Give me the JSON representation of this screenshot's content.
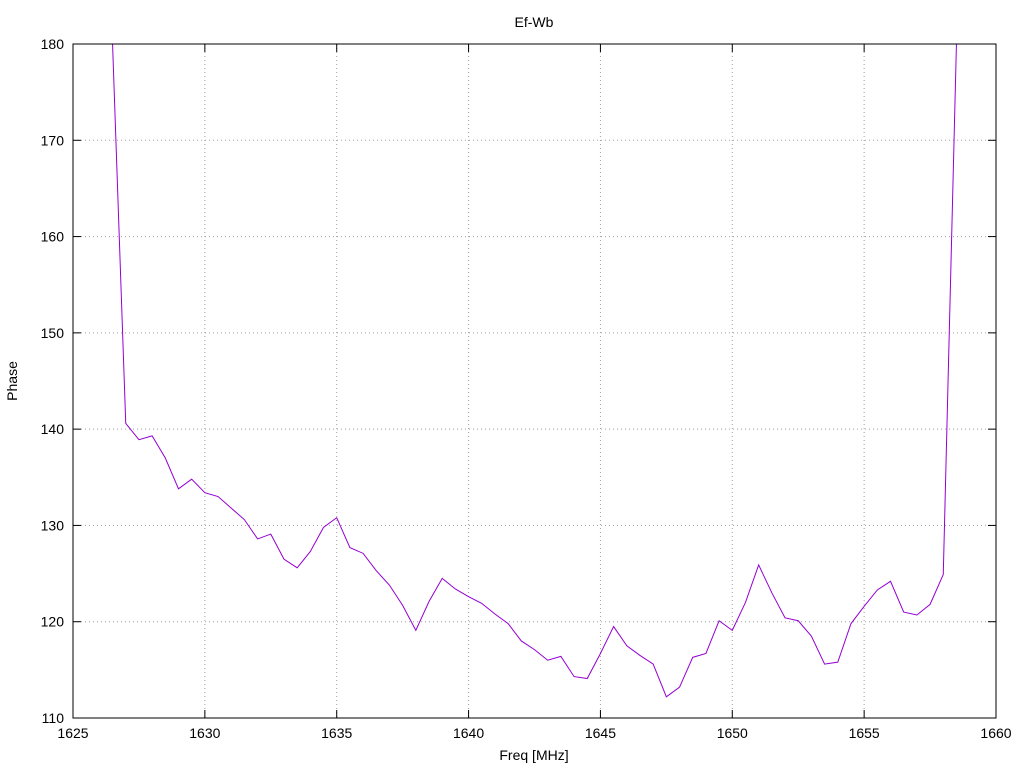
{
  "chart_data": {
    "type": "line",
    "title": "Ef-Wb",
    "xlabel": "Freq [MHz]",
    "ylabel": "Phase",
    "xlim": [
      1625,
      1660
    ],
    "ylim": [
      110,
      180
    ],
    "xticks": [
      1625,
      1630,
      1635,
      1640,
      1645,
      1650,
      1655,
      1660
    ],
    "yticks": [
      110,
      120,
      130,
      140,
      150,
      160,
      170,
      180
    ],
    "grid": true,
    "legend": "none",
    "series": [
      {
        "color": "#9400d3",
        "x": [
          1626.5,
          1627.0,
          1627.5,
          1628.0,
          1628.5,
          1629.0,
          1629.5,
          1630.0,
          1630.5,
          1631.0,
          1631.5,
          1632.0,
          1632.5,
          1633.0,
          1633.5,
          1634.0,
          1634.5,
          1635.0,
          1635.5,
          1636.0,
          1636.5,
          1637.0,
          1637.5,
          1638.0,
          1638.5,
          1639.0,
          1639.5,
          1640.0,
          1640.5,
          1641.0,
          1641.5,
          1642.0,
          1642.5,
          1643.0,
          1643.5,
          1644.0,
          1644.5,
          1645.0,
          1645.5,
          1646.0,
          1646.5,
          1647.0,
          1647.5,
          1648.0,
          1648.5,
          1649.0,
          1649.5,
          1650.0,
          1650.5,
          1651.0,
          1651.5,
          1652.0,
          1652.5,
          1653.0,
          1653.5,
          1654.0,
          1654.5,
          1655.0,
          1655.5,
          1656.0,
          1656.5,
          1657.0,
          1657.5,
          1658.0,
          1658.5
        ],
        "y": [
          180.0,
          140.6,
          138.9,
          139.3,
          137.0,
          133.8,
          134.8,
          133.4,
          133.0,
          131.8,
          130.6,
          128.6,
          129.1,
          126.5,
          125.6,
          127.3,
          129.8,
          130.8,
          127.7,
          127.1,
          125.3,
          123.8,
          121.7,
          119.1,
          122.1,
          124.5,
          123.4,
          122.6,
          121.9,
          120.8,
          119.8,
          118.0,
          117.1,
          116.0,
          116.4,
          114.3,
          114.1,
          116.7,
          119.5,
          117.5,
          116.5,
          115.6,
          112.2,
          113.2,
          116.3,
          116.7,
          120.1,
          119.1,
          122.0,
          125.9,
          123.0,
          120.4,
          120.1,
          118.5,
          115.6,
          115.8,
          119.8,
          121.6,
          123.3,
          124.2,
          121.0,
          120.7,
          121.8,
          124.9,
          180.0
        ]
      }
    ]
  }
}
